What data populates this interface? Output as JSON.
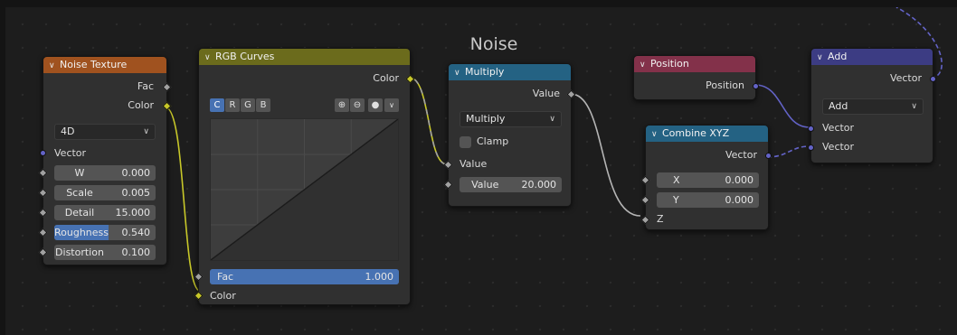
{
  "frame": {
    "title": "Noise"
  },
  "nodes": {
    "noise_texture": {
      "title": "Noise Texture",
      "outputs": [
        "Fac",
        "Color"
      ],
      "dimension": "4D",
      "vector_input": "Vector",
      "fields": [
        {
          "label": "W",
          "value": "0.000"
        },
        {
          "label": "Scale",
          "value": "0.005"
        },
        {
          "label": "Detail",
          "value": "15.000"
        },
        {
          "label": "Roughness",
          "value": "0.540",
          "fraction": 0.54
        },
        {
          "label": "Distortion",
          "value": "0.100"
        }
      ],
      "header_color": "#a0521f"
    },
    "rgb_curves": {
      "title": "RGB Curves",
      "output": "Color",
      "channels": [
        "C",
        "R",
        "G",
        "B"
      ],
      "active_channel": "C",
      "fac": {
        "label": "Fac",
        "value": "1.000",
        "fraction": 1.0
      },
      "color_input": "Color",
      "header_color": "#6b6b1c"
    },
    "multiply": {
      "title": "Multiply",
      "output": "Value",
      "operation": "Multiply",
      "clamp": "Clamp",
      "input_value": "Value",
      "value_field": {
        "label": "Value",
        "value": "20.000"
      },
      "header_color": "#246283"
    },
    "position": {
      "title": "Position",
      "output": "Position",
      "header_color": "#83314a"
    },
    "combine_xyz": {
      "title": "Combine XYZ",
      "output": "Vector",
      "fields": [
        {
          "label": "X",
          "value": "0.000"
        },
        {
          "label": "Y",
          "value": "0.000"
        }
      ],
      "z_input": "Z",
      "header_color": "#246283"
    },
    "add": {
      "title": "Add",
      "output": "Vector",
      "operation": "Add",
      "inputs": [
        "Vector",
        "Vector"
      ],
      "header_color": "#3c3c83"
    }
  },
  "colors": {
    "float_socket": "#a1a1a1",
    "color_socket": "#c7c729",
    "vector_socket": "#6363c7",
    "accent": "#4772b3"
  }
}
